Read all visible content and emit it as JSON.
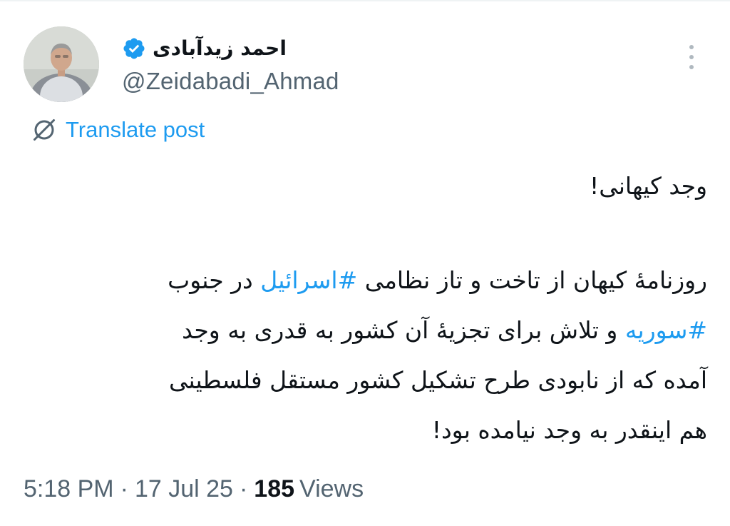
{
  "author": {
    "display_name": "احمد زیدآبادی",
    "handle": "@Zeidabadi_Ahmad",
    "verified_icon": "verified-badge-icon",
    "badge_color": "#1d9bf0"
  },
  "menu": {
    "icon": "more-vertical-icon"
  },
  "translate": {
    "icon": "globe-icon",
    "label": "Translate post",
    "color": "#1d9bf0"
  },
  "tweet": {
    "paragraph1": "وجد کیهانی!",
    "line1_a": "روزنامهٔ کیهان از تاخت و تاز نظامی ",
    "line1_hashtag": "#اسرائیل",
    "line1_b": " در جنوب",
    "line2_hashtag": "#سوریه",
    "line2_b": " و تلاش برای تجزیهٔ آن کشور به قدری به وجد",
    "line3": "آمده که از نابودی طرح تشکیل کشور مستقل فلسطینی",
    "line4": "هم اینقدر به وجد نیامده بود!",
    "hashtag_color": "#1d9bf0"
  },
  "meta": {
    "time": "5:18 PM",
    "separator": "·",
    "date": "17 Jul 25",
    "views_count": "185",
    "views_label": "Views"
  }
}
